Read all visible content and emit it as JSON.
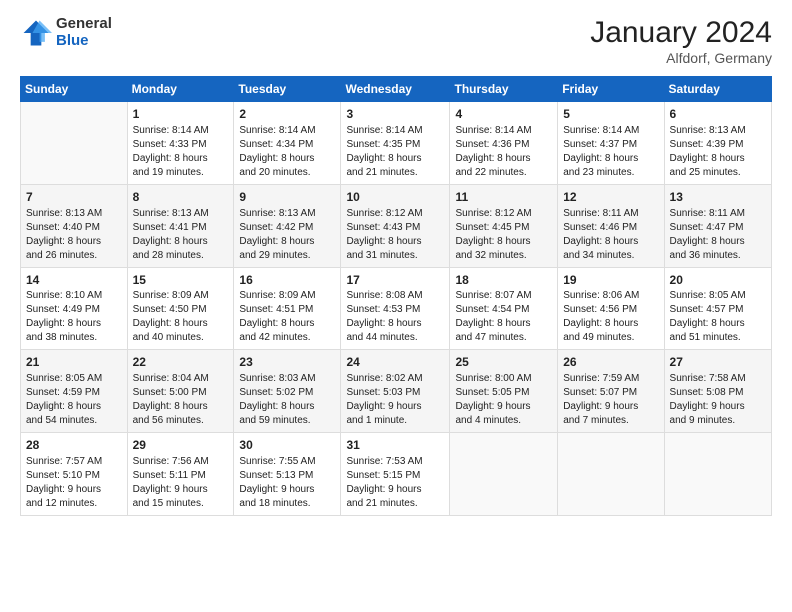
{
  "logo": {
    "general": "General",
    "blue": "Blue"
  },
  "header": {
    "month": "January 2024",
    "location": "Alfdorf, Germany"
  },
  "weekdays": [
    "Sunday",
    "Monday",
    "Tuesday",
    "Wednesday",
    "Thursday",
    "Friday",
    "Saturday"
  ],
  "weeks": [
    [
      {
        "day": "",
        "info": ""
      },
      {
        "day": "1",
        "info": "Sunrise: 8:14 AM\nSunset: 4:33 PM\nDaylight: 8 hours\nand 19 minutes."
      },
      {
        "day": "2",
        "info": "Sunrise: 8:14 AM\nSunset: 4:34 PM\nDaylight: 8 hours\nand 20 minutes."
      },
      {
        "day": "3",
        "info": "Sunrise: 8:14 AM\nSunset: 4:35 PM\nDaylight: 8 hours\nand 21 minutes."
      },
      {
        "day": "4",
        "info": "Sunrise: 8:14 AM\nSunset: 4:36 PM\nDaylight: 8 hours\nand 22 minutes."
      },
      {
        "day": "5",
        "info": "Sunrise: 8:14 AM\nSunset: 4:37 PM\nDaylight: 8 hours\nand 23 minutes."
      },
      {
        "day": "6",
        "info": "Sunrise: 8:13 AM\nSunset: 4:39 PM\nDaylight: 8 hours\nand 25 minutes."
      }
    ],
    [
      {
        "day": "7",
        "info": ""
      },
      {
        "day": "8",
        "info": "Sunrise: 8:13 AM\nSunset: 4:41 PM\nDaylight: 8 hours\nand 28 minutes."
      },
      {
        "day": "9",
        "info": "Sunrise: 8:13 AM\nSunset: 4:42 PM\nDaylight: 8 hours\nand 29 minutes."
      },
      {
        "day": "10",
        "info": "Sunrise: 8:12 AM\nSunset: 4:43 PM\nDaylight: 8 hours\nand 31 minutes."
      },
      {
        "day": "11",
        "info": "Sunrise: 8:12 AM\nSunset: 4:45 PM\nDaylight: 8 hours\nand 32 minutes."
      },
      {
        "day": "12",
        "info": "Sunrise: 8:11 AM\nSunset: 4:46 PM\nDaylight: 8 hours\nand 34 minutes."
      },
      {
        "day": "13",
        "info": "Sunrise: 8:11 AM\nSunset: 4:47 PM\nDaylight: 8 hours\nand 36 minutes."
      }
    ],
    [
      {
        "day": "14",
        "info": "Sunrise: 8:10 AM\nSunset: 4:49 PM\nDaylight: 8 hours\nand 38 minutes."
      },
      {
        "day": "15",
        "info": "Sunrise: 8:09 AM\nSunset: 4:50 PM\nDaylight: 8 hours\nand 40 minutes."
      },
      {
        "day": "16",
        "info": "Sunrise: 8:09 AM\nSunset: 4:51 PM\nDaylight: 8 hours\nand 42 minutes."
      },
      {
        "day": "17",
        "info": "Sunrise: 8:08 AM\nSunset: 4:53 PM\nDaylight: 8 hours\nand 44 minutes."
      },
      {
        "day": "18",
        "info": "Sunrise: 8:07 AM\nSunset: 4:54 PM\nDaylight: 8 hours\nand 47 minutes."
      },
      {
        "day": "19",
        "info": "Sunrise: 8:06 AM\nSunset: 4:56 PM\nDaylight: 8 hours\nand 49 minutes."
      },
      {
        "day": "20",
        "info": "Sunrise: 8:05 AM\nSunset: 4:57 PM\nDaylight: 8 hours\nand 51 minutes."
      }
    ],
    [
      {
        "day": "21",
        "info": "Sunrise: 8:05 AM\nSunset: 4:59 PM\nDaylight: 8 hours\nand 54 minutes."
      },
      {
        "day": "22",
        "info": "Sunrise: 8:04 AM\nSunset: 5:00 PM\nDaylight: 8 hours\nand 56 minutes."
      },
      {
        "day": "23",
        "info": "Sunrise: 8:03 AM\nSunset: 5:02 PM\nDaylight: 8 hours\nand 59 minutes."
      },
      {
        "day": "24",
        "info": "Sunrise: 8:02 AM\nSunset: 5:03 PM\nDaylight: 9 hours\nand 1 minute."
      },
      {
        "day": "25",
        "info": "Sunrise: 8:00 AM\nSunset: 5:05 PM\nDaylight: 9 hours\nand 4 minutes."
      },
      {
        "day": "26",
        "info": "Sunrise: 7:59 AM\nSunset: 5:07 PM\nDaylight: 9 hours\nand 7 minutes."
      },
      {
        "day": "27",
        "info": "Sunrise: 7:58 AM\nSunset: 5:08 PM\nDaylight: 9 hours\nand 9 minutes."
      }
    ],
    [
      {
        "day": "28",
        "info": "Sunrise: 7:57 AM\nSunset: 5:10 PM\nDaylight: 9 hours\nand 12 minutes."
      },
      {
        "day": "29",
        "info": "Sunrise: 7:56 AM\nSunset: 5:11 PM\nDaylight: 9 hours\nand 15 minutes."
      },
      {
        "day": "30",
        "info": "Sunrise: 7:55 AM\nSunset: 5:13 PM\nDaylight: 9 hours\nand 18 minutes."
      },
      {
        "day": "31",
        "info": "Sunrise: 7:53 AM\nSunset: 5:15 PM\nDaylight: 9 hours\nand 21 minutes."
      },
      {
        "day": "",
        "info": ""
      },
      {
        "day": "",
        "info": ""
      },
      {
        "day": "",
        "info": ""
      }
    ]
  ],
  "week1_sun_info": "Sunrise: 8:13 AM\nSunset: 4:40 PM\nDaylight: 8 hours\nand 26 minutes."
}
